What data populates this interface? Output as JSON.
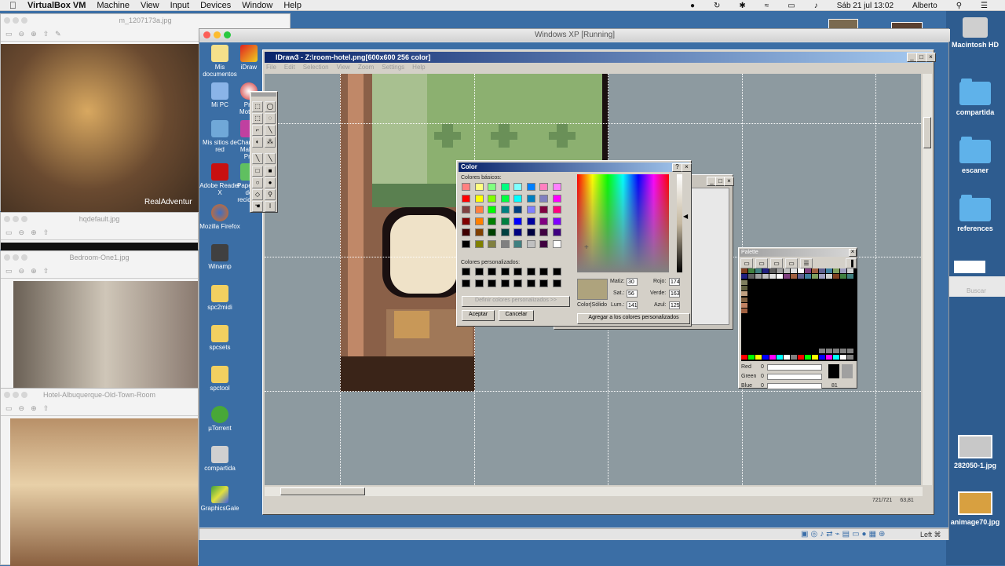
{
  "menubar": {
    "apple": "",
    "app": "VirtualBox VM",
    "items": [
      "Machine",
      "View",
      "Input",
      "Devices",
      "Window",
      "Help"
    ],
    "clock": "Sáb 21 jul  13:02",
    "user": "Alberto"
  },
  "mac_desktop": {
    "icons": [
      {
        "label": "Macintosh HD"
      },
      {
        "label": "compartida"
      },
      {
        "label": "escaner"
      },
      {
        "label": "references"
      },
      {
        "label": "282050-1.jpg"
      },
      {
        "label": "animage70.jpg"
      }
    ],
    "search_label": "Buscar"
  },
  "preview_windows": [
    {
      "title": "m_1207173a.jpg",
      "watermark": "RealAdventur"
    },
    {
      "title": "hqdefault.jpg"
    },
    {
      "title": "Bedroom-One1.jpg"
    },
    {
      "title": "Hotel-Albuquerque-Old-Town-Room"
    }
  ],
  "vbox": {
    "title": "Windows XP [Running]",
    "status_right": "Left ⌘"
  },
  "xp_desktop": {
    "icons": [
      {
        "label": "Mis documentos"
      },
      {
        "label": "Mi PC"
      },
      {
        "label": "Mis sitios de red"
      },
      {
        "label": "Adobe Reader X"
      },
      {
        "label": "Mozilla Firefox"
      },
      {
        "label": "Winamp"
      },
      {
        "label": "spc2midi"
      },
      {
        "label": "spcsets"
      },
      {
        "label": "spctool"
      },
      {
        "label": "µTorrent"
      },
      {
        "label": "compartida"
      },
      {
        "label": "GraphicsGale"
      },
      {
        "label": "iDraw"
      },
      {
        "label": "Pro Motion"
      },
      {
        "label": "Character Maker Pro"
      },
      {
        "label": "Papelera de reciclaje"
      }
    ]
  },
  "idraw": {
    "title": "IDraw3 - Z:\\room-hotel.png[600x600 256 color]",
    "menu": [
      "File",
      "Edit",
      "Selection",
      "View",
      "Zoom",
      "Settings",
      "Help"
    ],
    "status_pos": "721/721",
    "status_zoom": "63,81"
  },
  "color_dialog": {
    "title": "Color",
    "basic_colors_label": "Colores básicos:",
    "custom_colors_label": "Colores personalizados:",
    "define_custom_label": "Definir colores personalizados >>",
    "accept_label": "Aceptar",
    "cancel_label": "Cancelar",
    "add_custom_label": "Agregar a los colores personalizados",
    "solid_label": "Color|Sólido",
    "hue_label": "Matiz:",
    "hue": "30",
    "sat_label": "Sat.:",
    "sat": "56",
    "lum_label": "Lum.:",
    "lum": "141",
    "red_label": "Rojo:",
    "red": "174",
    "green_label": "Verde:",
    "green": "163",
    "blue_label": "Azul:",
    "blue": "125",
    "help_btn": "?",
    "close_btn": "×",
    "basic_colors": [
      "#ff8080",
      "#ffff80",
      "#80ff80",
      "#00ff80",
      "#80ffff",
      "#0080ff",
      "#ff80c0",
      "#ff80ff",
      "#ff0000",
      "#ffff00",
      "#80ff00",
      "#00ff40",
      "#00ffff",
      "#0080c0",
      "#8080c0",
      "#ff00ff",
      "#804040",
      "#ff8040",
      "#00ff00",
      "#008080",
      "#004080",
      "#8080ff",
      "#800040",
      "#ff0080",
      "#800000",
      "#ff8000",
      "#008000",
      "#008040",
      "#0000ff",
      "#0000a0",
      "#800080",
      "#8000ff",
      "#400000",
      "#804000",
      "#004000",
      "#004040",
      "#000080",
      "#000040",
      "#400040",
      "#400080",
      "#000000",
      "#808000",
      "#808040",
      "#808080",
      "#408080",
      "#c0c0c0",
      "#400040",
      "#ffffff"
    ],
    "current_color": "#aea37d"
  },
  "palette": {
    "title": "Palette",
    "red_label": "Red",
    "red": "0",
    "green_label": "Green",
    "green": "0",
    "blue_label": "Blue",
    "blue": "0",
    "index": "81"
  }
}
